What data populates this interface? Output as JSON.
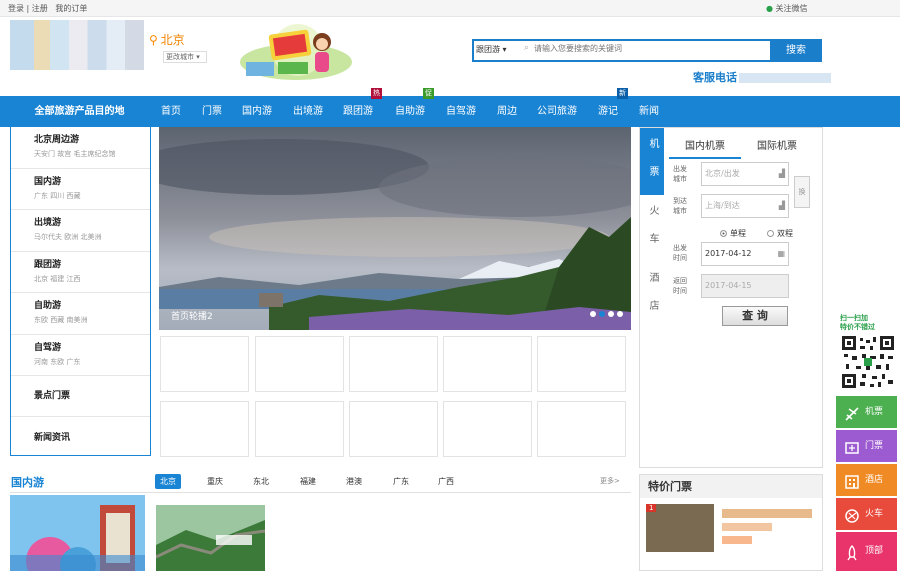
{
  "topbar": {
    "login": "登录 | 注册",
    "orders": "我的订单",
    "wechat": "关注微信"
  },
  "location": {
    "city": "北京",
    "change": "更改城市 ▾"
  },
  "search": {
    "category": "跟团游 ▾",
    "placeholder": "请输入您要搜索的关键词",
    "button": "搜索"
  },
  "hotline": {
    "label": "客服电话"
  },
  "nav": {
    "all": "全部旅游产品目的地",
    "items": [
      {
        "label": "首页"
      },
      {
        "label": "门票"
      },
      {
        "label": "国内游"
      },
      {
        "label": "出境游"
      },
      {
        "label": "跟团游",
        "tag": "热"
      },
      {
        "label": "自助游",
        "tag": "促"
      },
      {
        "label": "自驾游"
      },
      {
        "label": "周边"
      },
      {
        "label": "公司旅游"
      },
      {
        "label": "游记",
        "tag": "新"
      },
      {
        "label": "新闻"
      }
    ]
  },
  "sidebar": {
    "items": [
      {
        "title": "北京周边游",
        "sub": "天安门 故宫 毛主席纪念馆"
      },
      {
        "title": "国内游",
        "sub": "广东 四川 西藏"
      },
      {
        "title": "出境游",
        "sub": "马尔代夫 欧洲 北美洲"
      },
      {
        "title": "跟团游",
        "sub": "北京 福建 江西"
      },
      {
        "title": "自助游",
        "sub": "东欧 西藏 南美洲"
      },
      {
        "title": "自驾游",
        "sub": "河南 东欧 广东"
      },
      {
        "title": "景点门票",
        "sub": ""
      },
      {
        "title": "新闻资讯",
        "sub": ""
      }
    ]
  },
  "hero": {
    "caption": "首页轮播2",
    "slide_count": 4,
    "active_slide": 2
  },
  "ticket": {
    "vtabs": [
      "机票",
      "火车",
      "酒店"
    ],
    "tabs": [
      "国内机票",
      "国际机票"
    ],
    "from_label": "出发\n城市",
    "from_placeholder": "北京/出发",
    "to_label": "到达\n城市",
    "to_placeholder": "上海/到达",
    "swap": "换",
    "oneway": "单程",
    "roundtrip": "双程",
    "depart_label": "出发\n时间",
    "depart_date": "2017-04-12",
    "return_label": "返回\n时间",
    "return_date": "2017-04-15",
    "query": "查 询"
  },
  "domestic": {
    "title": "国内游",
    "tabs": [
      "北京",
      "重庆",
      "东北",
      "福建",
      "港澳",
      "广东",
      "广西"
    ],
    "more": "更多>"
  },
  "special": {
    "title": "特价门票"
  },
  "float": {
    "qr_label": "扫一扫加\n特价不错过",
    "buttons": [
      {
        "label": "机票",
        "color": "#4caf50"
      },
      {
        "label": "门票",
        "color": "#9c5bd0"
      },
      {
        "label": "酒店",
        "color": "#f08a24"
      },
      {
        "label": "火车",
        "color": "#e84a3c"
      },
      {
        "label": "顶部",
        "color": "#e8336b"
      }
    ]
  },
  "colors": {
    "brand_blue": "#1a84d4",
    "accent_orange": "#f08300"
  }
}
